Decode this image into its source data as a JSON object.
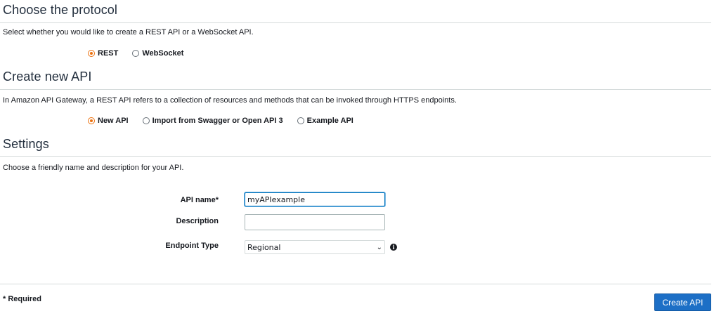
{
  "protocol": {
    "title": "Choose the protocol",
    "description": "Select whether you would like to create a REST API or a WebSocket API.",
    "options": [
      {
        "label": "REST",
        "checked": true
      },
      {
        "label": "WebSocket",
        "checked": false
      }
    ]
  },
  "create": {
    "title": "Create new API",
    "description": "In Amazon API Gateway, a REST API refers to a collection of resources and methods that can be invoked through HTTPS endpoints.",
    "options": [
      {
        "label": "New API",
        "checked": true
      },
      {
        "label": "Import from Swagger or Open API 3",
        "checked": false
      },
      {
        "label": "Example API",
        "checked": false
      }
    ]
  },
  "settings": {
    "title": "Settings",
    "description": "Choose a friendly name and description for your API.",
    "api_name_label": "API name*",
    "api_name_value": "myAPIexample",
    "description_label": "Description",
    "description_value": "",
    "endpoint_label": "Endpoint Type",
    "endpoint_value": "Regional",
    "info_icon": "info-icon"
  },
  "footer": {
    "required_label": "* Required",
    "create_button": "Create API"
  },
  "colors": {
    "accent_radio": "#ec7211",
    "primary_button": "#1d6fc6",
    "focus_border": "#0073bb"
  }
}
